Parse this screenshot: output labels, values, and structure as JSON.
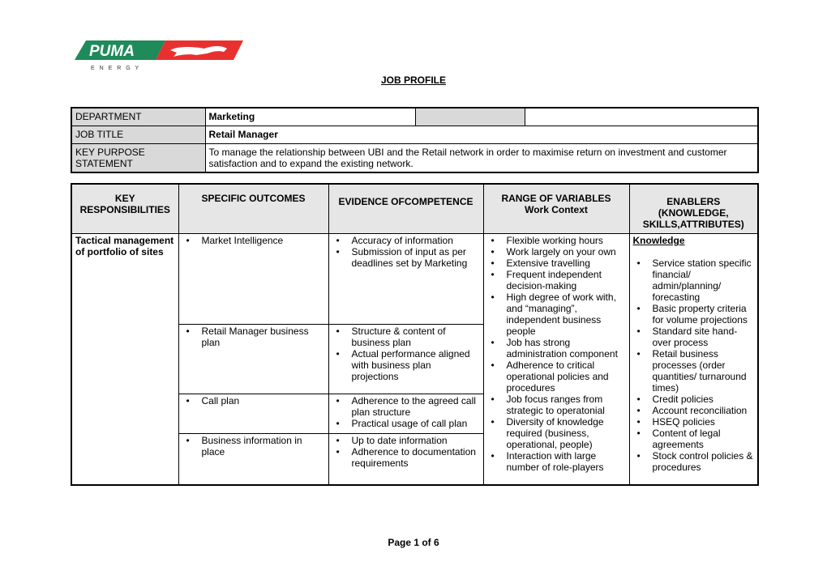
{
  "logo": {
    "brand": "PUMA",
    "tagline": "E N E R G Y",
    "colors": {
      "green": "#1f8a5a",
      "red": "#e8312f"
    }
  },
  "document": {
    "title": "JOB PROFILE",
    "footer": "Page 1 of 6"
  },
  "info_table": {
    "department_label": "DEPARTMENT",
    "department_value": "Marketing",
    "job_title_label": "JOB TITLE",
    "job_title_value": "Retail Manager",
    "purpose_label": "KEY PURPOSE STATEMENT",
    "purpose_value": "To manage the relationship between UBI and the Retail network in order to maximise return on investment and customer satisfaction and to expand the existing network."
  },
  "main_table": {
    "headers": {
      "key_resp": "KEY RESPONSIBILITIES",
      "outcomes": "SPECIFIC OUTCOMES",
      "evidence": "EVIDENCE OFCOMPETENCE",
      "range": "RANGE OF VARIABLES",
      "range_sub": "Work Context",
      "enablers": "ENABLERS (KNOWLEDGE, SKILLS,ATTRIBUTES)"
    },
    "key_responsibility": "Tactical management of portfolio of sites",
    "rows": [
      {
        "outcome": "Market Intelligence",
        "evidence": [
          "Accuracy of information",
          "Submission of input as per deadlines set by Marketing"
        ]
      },
      {
        "outcome": "Retail Manager business plan",
        "evidence": [
          "Structure & content of business plan",
          "Actual performance aligned with business plan projections"
        ]
      },
      {
        "outcome": "Call plan",
        "evidence": [
          "Adherence to the agreed call plan structure",
          "Practical usage of call plan"
        ]
      },
      {
        "outcome": "Business information in place",
        "evidence": [
          "Up to date information",
          "Adherence to documentation requirements"
        ]
      }
    ],
    "range_items": [
      "Flexible working hours",
      "Work largely on your own",
      "Extensive travelling",
      "Frequent independent decision-making",
      "High degree of work with, and “managing”, independent business people",
      "Job has strong administration component",
      "Adherence to critical operational policies and procedures",
      "Job focus ranges from strategic to operatonial",
      "Diversity of knowledge required (business, operational, people)",
      "Interaction with large number of role-players"
    ],
    "enablers_heading": "Knowledge",
    "enablers_items": [
      "Service station specific financial/ admin/planning/ forecasting",
      "Basic property criteria for volume projections",
      "Standard site hand-over process",
      "Retail business processes (order quantities/ turnaround times)",
      "Credit policies",
      "Account reconciliation",
      "HSEQ policies",
      "Content of legal agreements",
      "Stock control policies & procedures"
    ]
  }
}
